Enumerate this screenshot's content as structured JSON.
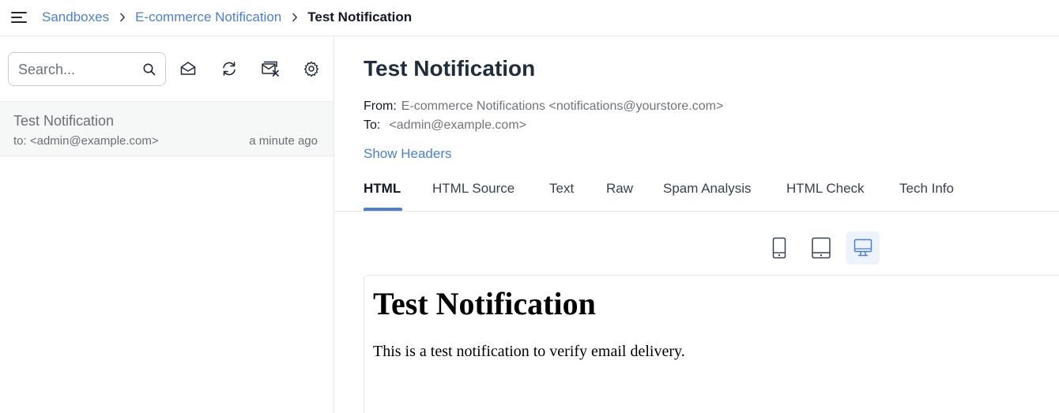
{
  "breadcrumb": {
    "items": [
      "Sandboxes",
      "E-commerce Notification"
    ],
    "current": "Test Notification"
  },
  "icons": {
    "menu": "hamburger-menu-icon",
    "separator": "chevron-right-icon",
    "search": "search-icon",
    "mark_read": "envelope-open-icon",
    "refresh": "refresh-icon",
    "clear": "mail-clear-icon",
    "settings": "gear-icon",
    "devices": [
      "mobile-icon",
      "tablet-icon",
      "desktop-icon"
    ]
  },
  "search": {
    "placeholder": "Search...",
    "value": ""
  },
  "inbox": {
    "items": [
      {
        "subject": "Test Notification",
        "to": "to: <admin@example.com>",
        "time": "a minute ago"
      }
    ]
  },
  "message": {
    "subject": "Test Notification",
    "from_label": "From:",
    "from_value": "E-commerce Notifications <notifications@yourstore.com>",
    "to_label": "To:",
    "to_value": "<admin@example.com>",
    "show_headers": "Show Headers",
    "tabs": [
      "HTML",
      "HTML Source",
      "Text",
      "Raw",
      "Spam Analysis",
      "HTML Check",
      "Tech Info"
    ],
    "active_tab": "HTML",
    "active_device": "desktop",
    "preview": {
      "heading": "Test Notification",
      "body": "This is a test notification to verify email delivery."
    }
  },
  "colors": {
    "accent": "#4a7fd4",
    "selected_row_bg": "#f6f7f7",
    "active_device_bg": "#eef3fb",
    "title": "#1f2d3d"
  }
}
